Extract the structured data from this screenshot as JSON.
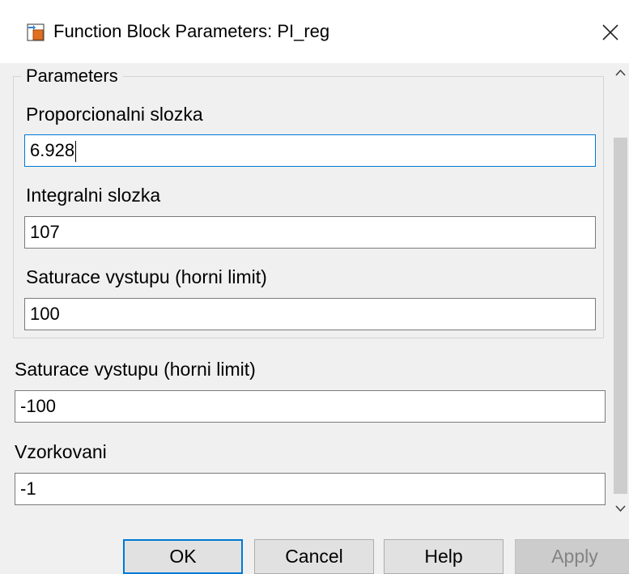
{
  "window": {
    "title": "Function Block Parameters: PI_reg",
    "app_icon": "simulink-block-icon",
    "close_icon": "close-icon"
  },
  "parameters_group": {
    "title": "Parameters",
    "fields": [
      {
        "label": "Proporcionalni slozka",
        "value": "6.928"
      },
      {
        "label": "Integralni slozka",
        "value": "107"
      },
      {
        "label": "Saturace vystupu (horni limit)",
        "value": "100"
      }
    ]
  },
  "extra_fields": [
    {
      "label": "Saturace vystupu (horni limit)",
      "value": "-100"
    },
    {
      "label": "Vzorkovani",
      "value": "-1"
    }
  ],
  "buttons": {
    "ok": "OK",
    "cancel": "Cancel",
    "help": "Help",
    "apply": "Apply"
  },
  "colors": {
    "accent": "#0078d7",
    "dialog_bg": "#f0f0f0",
    "disabled_text": "#838383"
  }
}
